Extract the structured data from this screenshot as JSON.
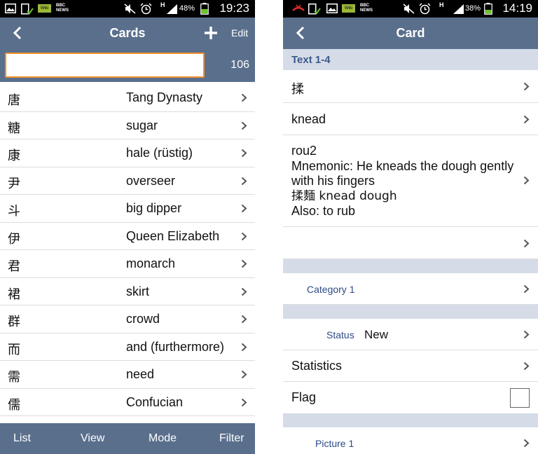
{
  "left": {
    "status": {
      "time": "19:23",
      "battery": "48%",
      "network": "H"
    },
    "nav": {
      "title": "Cards",
      "edit_label": "Edit"
    },
    "search": {
      "value": "",
      "count": "106"
    },
    "cards": [
      {
        "char": "唐",
        "meaning": "Tang Dynasty"
      },
      {
        "char": "糖",
        "meaning": "sugar"
      },
      {
        "char": "康",
        "meaning": "hale (rüstig)"
      },
      {
        "char": "尹",
        "meaning": "overseer"
      },
      {
        "char": "斗",
        "meaning": "big dipper"
      },
      {
        "char": "伊",
        "meaning": "Queen Elizabeth"
      },
      {
        "char": "君",
        "meaning": "monarch"
      },
      {
        "char": "裙",
        "meaning": "skirt"
      },
      {
        "char": "群",
        "meaning": "crowd"
      },
      {
        "char": "而",
        "meaning": "and (furthermore)"
      },
      {
        "char": "需",
        "meaning": "need"
      },
      {
        "char": "儒",
        "meaning": "Confucian"
      }
    ],
    "toolbar": {
      "list": "List",
      "view": "View",
      "mode": "Mode",
      "filter": "Filter"
    }
  },
  "right": {
    "status": {
      "time": "14:19",
      "battery": "38%",
      "network": "H"
    },
    "nav": {
      "title": "Card"
    },
    "section_title": "Text 1-4",
    "text1": "揉",
    "text2": "knead",
    "text3_lines": [
      "rou2",
      "Mnemonic: He kneads the dough gently",
      "with his fingers",
      "揉麵 knead dough",
      "Also: to rub"
    ],
    "text4": "",
    "category_label": "Category 1",
    "status_label": "Status",
    "status_value": "New",
    "statistics_label": "Statistics",
    "flag_label": "Flag",
    "flag_checked": false,
    "picture_label": "Picture 1"
  },
  "colors": {
    "nav_bar": "#5a6f8c",
    "section_bg": "#d5dce8",
    "link_text": "#2c4a86",
    "search_border": "#f3902e",
    "battery_green": "#6cc22a"
  },
  "icons": {
    "back": "chevron-left-icon",
    "add": "plus-icon",
    "row": "chevron-right-icon",
    "mute": "mute-icon",
    "alarm": "alarm-icon",
    "signal": "signal-icon",
    "battery": "battery-icon"
  }
}
